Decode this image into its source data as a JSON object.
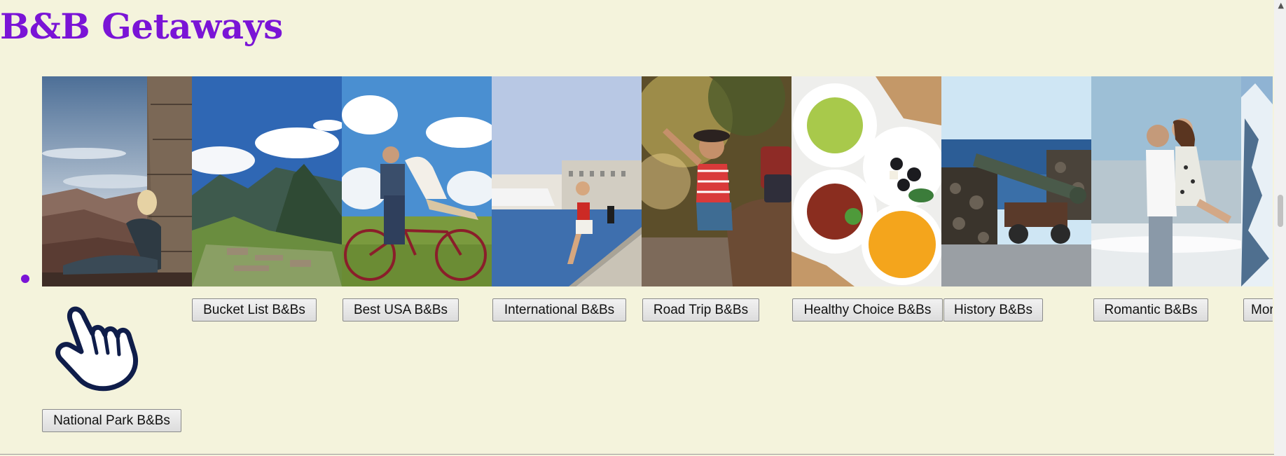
{
  "page": {
    "title": "B&B Getaways"
  },
  "carousel": {
    "tiles": [
      {
        "image": "grand-canyon-woman-photo",
        "label": "National Park B&Bs"
      },
      {
        "image": "machu-picchu-photo",
        "label": "Bucket List B&Bs"
      },
      {
        "image": "couple-bicycle-photo",
        "label": "Best USA B&Bs"
      },
      {
        "image": "harbor-woman-photo",
        "label": "International B&Bs"
      },
      {
        "image": "road-trip-woman-car-photo",
        "label": "Road Trip B&Bs"
      },
      {
        "image": "healthy-breakfast-plates-photo",
        "label": "Healthy Choice B&Bs"
      },
      {
        "image": "coastal-cannon-photo",
        "label": "History B&Bs"
      },
      {
        "image": "romantic-couple-beach-photo",
        "label": "Romantic B&Bs"
      },
      {
        "image": "snowy-mountain-photo",
        "label": "More B&Bs"
      }
    ]
  },
  "cursor": {
    "icon": "pointing-hand-cursor-icon"
  },
  "colors": {
    "title": "#7a14d6",
    "background": "#f4f3dc"
  }
}
